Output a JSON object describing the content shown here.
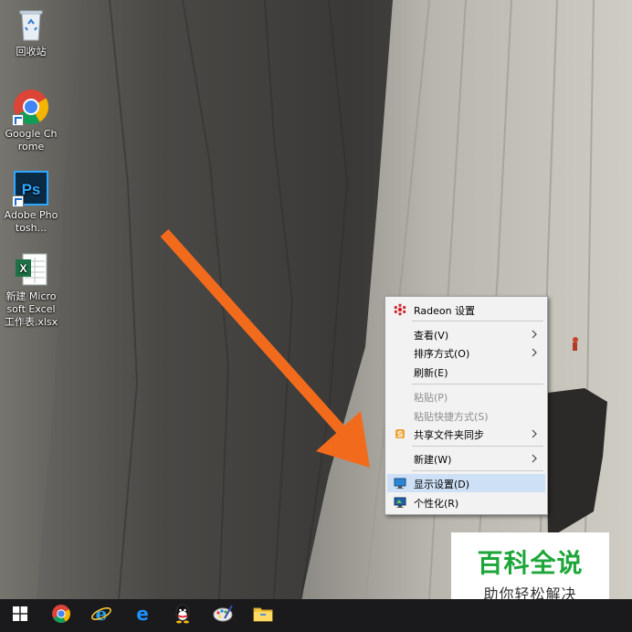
{
  "desktop": {
    "icons": [
      {
        "name": "recycle-bin",
        "label": "回收站",
        "icon": "recycle-bin-icon"
      },
      {
        "name": "google-chrome",
        "label": "Google Chrome",
        "icon": "chrome-icon"
      },
      {
        "name": "adobe-photoshop",
        "label": "Adobe Photosh...",
        "icon": "photoshop-icon"
      },
      {
        "name": "new-excel-sheet",
        "label": "新建 Microsoft Excel 工作表.xlsx",
        "icon": "excel-icon"
      }
    ]
  },
  "context_menu": {
    "items": [
      {
        "label": "Radeon 设置",
        "icon": "radeon-icon",
        "enabled": true,
        "submenu": false
      },
      {
        "label": "查看(V)",
        "enabled": true,
        "submenu": true
      },
      {
        "label": "排序方式(O)",
        "enabled": true,
        "submenu": true
      },
      {
        "label": "刷新(E)",
        "enabled": true,
        "submenu": false
      },
      {
        "label": "粘贴(P)",
        "enabled": false,
        "submenu": false
      },
      {
        "label": "粘贴快捷方式(S)",
        "enabled": false,
        "submenu": false
      },
      {
        "label": "共享文件夹同步",
        "icon": "share-sync-icon",
        "enabled": true,
        "submenu": true
      },
      {
        "label": "新建(W)",
        "enabled": true,
        "submenu": true
      },
      {
        "label": "显示设置(D)",
        "icon": "display-settings-icon",
        "enabled": true,
        "submenu": false,
        "highlighted": true
      },
      {
        "label": "个性化(R)",
        "icon": "personalize-icon",
        "enabled": true,
        "submenu": false
      }
    ]
  },
  "annotation": {
    "type": "arrow",
    "color": "#f26b1d",
    "points_to": "显示设置(D)"
  },
  "watermark": {
    "title": "百科全说",
    "subtitle": "助你轻松解决",
    "title_color": "#1fa63a"
  },
  "taskbar": {
    "buttons": [
      "start-icon",
      "chrome-icon",
      "internet-explorer-icon",
      "edge-icon",
      "qq-icon",
      "paint-icon",
      "file-explorer-icon"
    ]
  },
  "colors": {
    "menu_bg": "#f2f2f2",
    "menu_highlight": "#cde0f6",
    "taskbar_bg": "#1a1a1c"
  }
}
